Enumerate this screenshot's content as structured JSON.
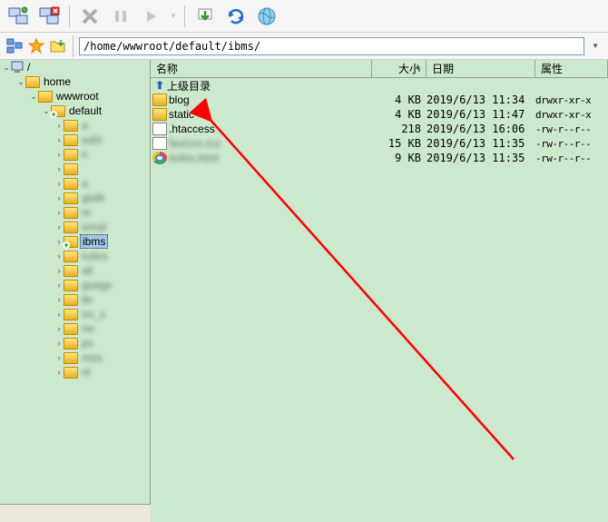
{
  "path": "/home/wwwroot/default/ibms/",
  "tree": {
    "root": "/",
    "nodes": [
      {
        "label": "home",
        "depth": 1,
        "expand": "v",
        "blur": false,
        "plus": false
      },
      {
        "label": "wwwroot",
        "depth": 2,
        "expand": "v",
        "blur": false,
        "plus": false
      },
      {
        "label": "default",
        "depth": 3,
        "expand": "v",
        "blur": false,
        "plus": true
      },
      {
        "label": "a",
        "depth": 4,
        "expand": ">",
        "blur": true,
        "plus": false
      },
      {
        "label": "safe",
        "depth": 4,
        "expand": ">",
        "blur": true,
        "plus": false
      },
      {
        "label": "n",
        "depth": 4,
        "expand": ">",
        "blur": true,
        "plus": false
      },
      {
        "label": "",
        "depth": 4,
        "expand": ">",
        "blur": true,
        "plus": false
      },
      {
        "label": "a",
        "depth": 4,
        "expand": ">",
        "blur": true,
        "plus": false
      },
      {
        "label": "gtalk",
        "depth": 4,
        "expand": ">",
        "blur": true,
        "plus": false
      },
      {
        "label": "re",
        "depth": 4,
        "expand": ">",
        "blur": true,
        "plus": false
      },
      {
        "label": "ernal",
        "depth": 4,
        "expand": ">",
        "blur": true,
        "plus": false
      },
      {
        "label": "ibms",
        "depth": 4,
        "expand": ">",
        "blur": false,
        "plus": true,
        "selected": true
      },
      {
        "label": "ludes",
        "depth": 4,
        "expand": ">",
        "blur": true,
        "plus": false
      },
      {
        "label": "all",
        "depth": 4,
        "expand": ">",
        "blur": true,
        "plus": false
      },
      {
        "label": "guage",
        "depth": 4,
        "expand": ">",
        "blur": true,
        "plus": false
      },
      {
        "label": "ile",
        "depth": 4,
        "expand": ">",
        "blur": true,
        "plus": false
      },
      {
        "label": "on_s",
        "depth": 4,
        "expand": ">",
        "blur": true,
        "plus": false
      },
      {
        "label": "rer",
        "depth": 4,
        "expand": ">",
        "blur": true,
        "plus": false
      },
      {
        "label": "ps",
        "depth": 4,
        "expand": ">",
        "blur": true,
        "plus": false
      },
      {
        "label": "mes",
        "depth": 4,
        "expand": ">",
        "blur": true,
        "plus": false
      },
      {
        "label": "nl",
        "depth": 4,
        "expand": ">",
        "blur": true,
        "plus": false
      }
    ]
  },
  "columns": {
    "name": "名称",
    "size": "大小",
    "date": "日期",
    "attr": "属性"
  },
  "parent_dir": "上级目录",
  "files": [
    {
      "name": "blog",
      "size": "4 KB",
      "date": "2019/6/13 11:34",
      "attr": "drwxr-xr-x",
      "icon": "folder"
    },
    {
      "name": "static",
      "size": "4 KB",
      "date": "2019/6/13 11:47",
      "attr": "drwxr-xr-x",
      "icon": "folder"
    },
    {
      "name": ".htaccess",
      "size": "218",
      "date": "2019/6/13 16:06",
      "attr": "-rw-r--r--",
      "icon": "doc"
    },
    {
      "name": "favicon.ico",
      "size": "15 KB",
      "date": "2019/6/13 11:35",
      "attr": "-rw-r--r--",
      "icon": "doc",
      "blur": true
    },
    {
      "name": "index.html",
      "size": "9 KB",
      "date": "2019/6/13 11:35",
      "attr": "-rw-r--r--",
      "icon": "chrome",
      "blur": true
    }
  ]
}
